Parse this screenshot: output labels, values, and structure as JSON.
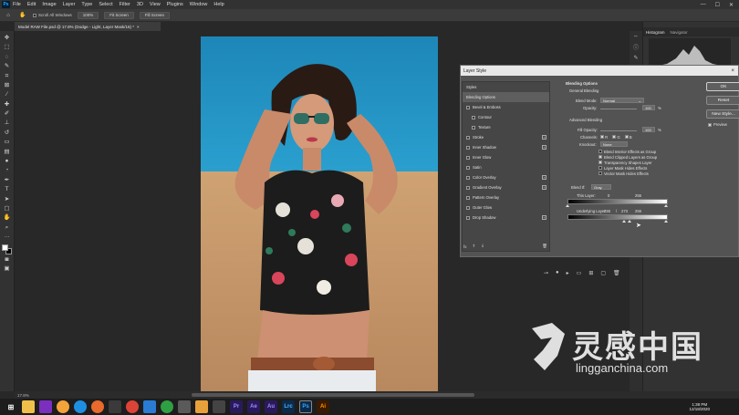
{
  "menubar": {
    "logo": "Ps",
    "items": [
      "File",
      "Edit",
      "Image",
      "Layer",
      "Type",
      "Select",
      "Filter",
      "3D",
      "View",
      "Plugins",
      "Window",
      "Help"
    ],
    "window_controls": [
      "—",
      "☐",
      "✕"
    ]
  },
  "optionsbar": {
    "scroll_all_windows": "Scroll All Windows",
    "zoom": "100%",
    "fit_screen": "Fit Screen",
    "fill_screen": "Fill Screen"
  },
  "document_tab": {
    "title": "Model RAW File.psd @ 17.8% (Dodge - Light, Layer Mask/16) *",
    "close": "×"
  },
  "panels": {
    "histogram_tab": "Histogram",
    "navigator_tab": "Navigator"
  },
  "dialog": {
    "title": "Layer Style",
    "close": "×",
    "styles_header": "Styles",
    "styles": [
      {
        "label": "Blending Options",
        "checkbox": false,
        "plus": false,
        "selected": true,
        "indent": false
      },
      {
        "label": "Bevel & Emboss",
        "checkbox": true,
        "plus": false,
        "selected": false,
        "indent": false
      },
      {
        "label": "Contour",
        "checkbox": true,
        "plus": false,
        "selected": false,
        "indent": true
      },
      {
        "label": "Texture",
        "checkbox": true,
        "plus": false,
        "selected": false,
        "indent": true
      },
      {
        "label": "Stroke",
        "checkbox": true,
        "plus": true,
        "selected": false,
        "indent": false
      },
      {
        "label": "Inner Shadow",
        "checkbox": true,
        "plus": true,
        "selected": false,
        "indent": false
      },
      {
        "label": "Inner Glow",
        "checkbox": true,
        "plus": false,
        "selected": false,
        "indent": false
      },
      {
        "label": "Satin",
        "checkbox": true,
        "plus": false,
        "selected": false,
        "indent": false
      },
      {
        "label": "Color Overlay",
        "checkbox": true,
        "plus": true,
        "selected": false,
        "indent": false
      },
      {
        "label": "Gradient Overlay",
        "checkbox": true,
        "plus": true,
        "selected": false,
        "indent": false
      },
      {
        "label": "Pattern Overlay",
        "checkbox": true,
        "plus": false,
        "selected": false,
        "indent": false
      },
      {
        "label": "Outer Glow",
        "checkbox": true,
        "plus": false,
        "selected": false,
        "indent": false
      },
      {
        "label": "Drop Shadow",
        "checkbox": true,
        "plus": true,
        "selected": false,
        "indent": false
      }
    ],
    "fx_label": "fx",
    "blending_options_title": "Blending Options",
    "general_blending": "General Blending",
    "blend_mode_label": "Blend Mode:",
    "blend_mode_value": "Normal",
    "opacity_label": "Opacity:",
    "opacity_value": "100",
    "opacity_unit": "%",
    "advanced_blending": "Advanced Blending",
    "fill_opacity_label": "Fill Opacity:",
    "fill_opacity_value": "100",
    "fill_opacity_unit": "%",
    "channels_label": "Channels:",
    "channels": [
      "R",
      "G",
      "B"
    ],
    "knockout_label": "Knockout:",
    "knockout_value": "None",
    "adv_checks": [
      {
        "label": "Blend Interior Effects as Group",
        "checked": false
      },
      {
        "label": "Blend Clipped Layers as Group",
        "checked": true
      },
      {
        "label": "Transparency Shapes Layer",
        "checked": true
      },
      {
        "label": "Layer Mask Hides Effects",
        "checked": false
      },
      {
        "label": "Vector Mask Hides Effects",
        "checked": false
      }
    ],
    "blend_if_label": "Blend If:",
    "blend_if_value": "Gray",
    "this_layer_label": "This Layer:",
    "this_layer_min": "0",
    "this_layer_max": "255",
    "underlying_label": "Underlying Layer:",
    "underlying_values": [
      "246",
      "/",
      "273",
      "255"
    ],
    "buttons": {
      "ok": "OK",
      "reset": "Reset",
      "new_style": "New Style...",
      "preview": "Preview"
    }
  },
  "statusbar": {
    "zoom": "17.8%"
  },
  "taskbar": {
    "time": "1:38 PM",
    "date": "12/18/2020"
  },
  "watermark": {
    "cn": "灵感中国",
    "en": "lingganchina.com"
  },
  "colors": {
    "sky": "#1e8fbf",
    "sand": "#cf9e70",
    "shirt": "#1a1a1a",
    "dialog": "#535353",
    "accent": "#31a8ff"
  }
}
